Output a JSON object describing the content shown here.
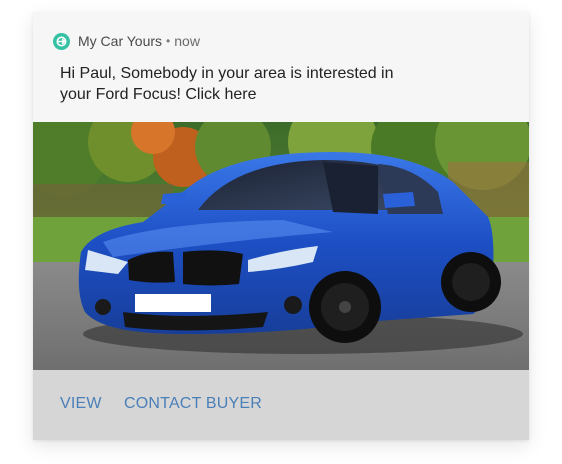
{
  "notification": {
    "app_name": "My Car Yours",
    "separator": "•",
    "time": "now",
    "app_icon": "car-swap-icon",
    "message": "Hi Paul, Somebody in your area is interested in your Ford Focus! Click here"
  },
  "image": {
    "subject": "blue-hatchback-car-photo"
  },
  "actions": {
    "view_label": "VIEW",
    "contact_label": "CONTACT BUYER"
  },
  "colors": {
    "accent": "#35c1a3",
    "action_text": "#4a7fb8",
    "action_bar": "#d6d6d6",
    "car_body": "#1d4fc4"
  }
}
